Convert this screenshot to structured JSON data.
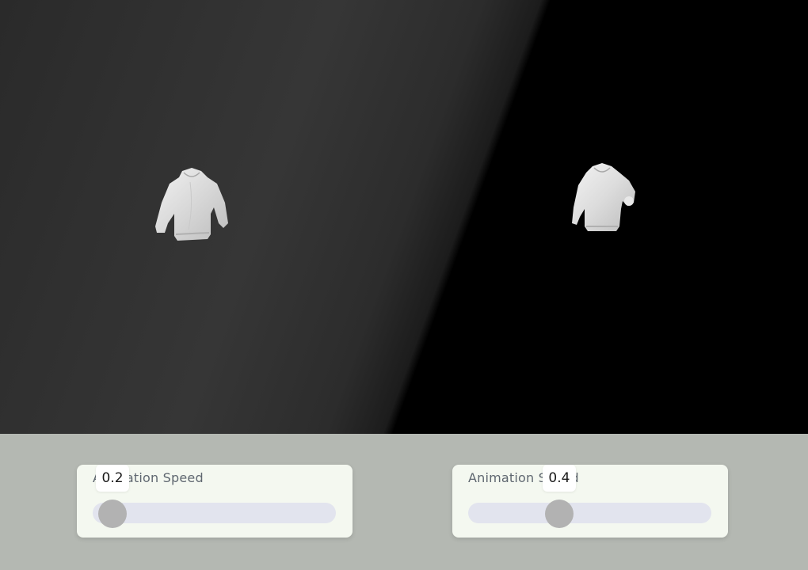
{
  "scene": {
    "models": [
      {
        "name": "left-sweatshirt"
      },
      {
        "name": "right-sweatshirt"
      }
    ]
  },
  "controls": [
    {
      "label": "Animation Speed",
      "value": "0.2",
      "fraction": 0.0
    },
    {
      "label": "Animation Speed",
      "value": "0.4",
      "fraction": 0.35
    }
  ],
  "colors": {
    "panel_bg": "#b4b8b2",
    "card_bg": "#f4f8f0",
    "track": "#e2e4ee",
    "thumb": "#b2b2b2",
    "label": "#5f6770"
  }
}
